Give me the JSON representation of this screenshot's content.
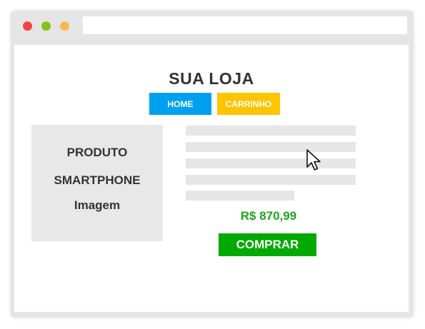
{
  "colors": {
    "window_frame": "#e5e5e5",
    "dot_red": "#f0453e",
    "dot_green": "#85c21e",
    "dot_yellow": "#f8b84e",
    "home_button": "#00a0f0",
    "cart_button": "#ffc400",
    "price": "#1aa81a",
    "buy_button": "#00aa00"
  },
  "header": {
    "title": "SUA LOJA"
  },
  "nav": {
    "home_label": "HOME",
    "cart_label": "CARRINHO"
  },
  "product": {
    "image_line1": "PRODUTO",
    "image_line2": "SMARTPHONE",
    "image_line3": "Imagem",
    "price": "R$ 870,99",
    "buy_label": "COMPRAR"
  },
  "icons": {
    "cursor": "arrow-cursor-icon"
  }
}
